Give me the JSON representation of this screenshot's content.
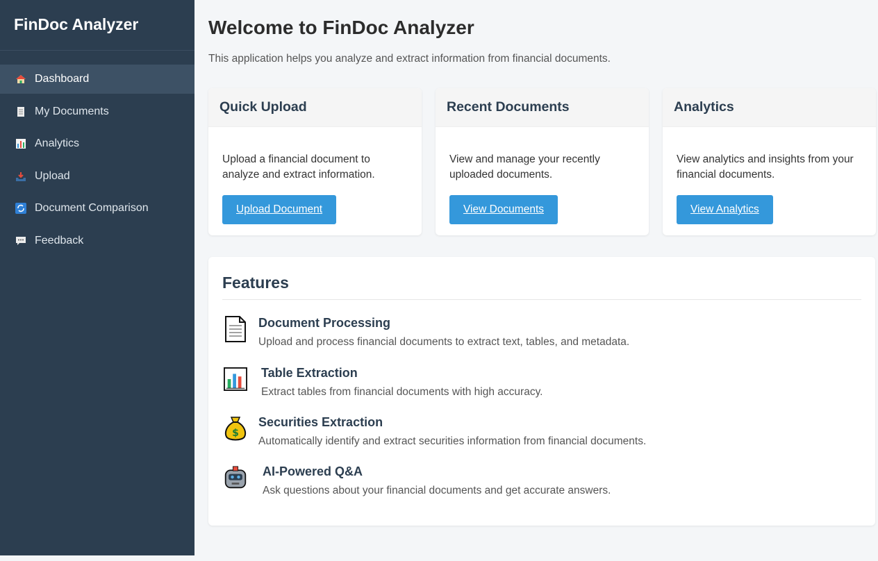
{
  "app": {
    "brand": "FinDoc Analyzer"
  },
  "sidebar": {
    "items": [
      {
        "label": "Dashboard",
        "icon": "house-icon",
        "active": true
      },
      {
        "label": "My Documents",
        "icon": "document-icon"
      },
      {
        "label": "Analytics",
        "icon": "bar-chart-icon"
      },
      {
        "label": "Upload",
        "icon": "inbox-tray-icon"
      },
      {
        "label": "Document Comparison",
        "icon": "refresh-icon"
      },
      {
        "label": "Feedback",
        "icon": "speech-bubble-icon"
      }
    ]
  },
  "main": {
    "title": "Welcome to FinDoc Analyzer",
    "intro": "This application helps you analyze and extract information from financial documents.",
    "cards": [
      {
        "title": "Quick Upload",
        "text": "Upload a financial document to analyze and extract information.",
        "button": "Upload Document"
      },
      {
        "title": "Recent Documents",
        "text": "View and manage your recently uploaded documents.",
        "button": "View Documents"
      },
      {
        "title": "Analytics",
        "text": "View analytics and insights from your financial documents.",
        "button": "View Analytics"
      }
    ],
    "features": {
      "title": "Features",
      "items": [
        {
          "title": "Document Processing",
          "text": "Upload and process financial documents to extract text, tables, and metadata.",
          "icon": "page-icon"
        },
        {
          "title": "Table Extraction",
          "text": "Extract tables from financial documents with high accuracy.",
          "icon": "chart-icon"
        },
        {
          "title": "Securities Extraction",
          "text": "Automatically identify and extract securities information from financial documents.",
          "icon": "money-bag-icon"
        },
        {
          "title": "AI-Powered Q&A",
          "text": "Ask questions about your financial documents and get accurate answers.",
          "icon": "robot-icon"
        }
      ]
    }
  },
  "colors": {
    "sidebar": "#2c3e50",
    "sidebar_active": "#3d5165",
    "accent": "#3498db"
  }
}
